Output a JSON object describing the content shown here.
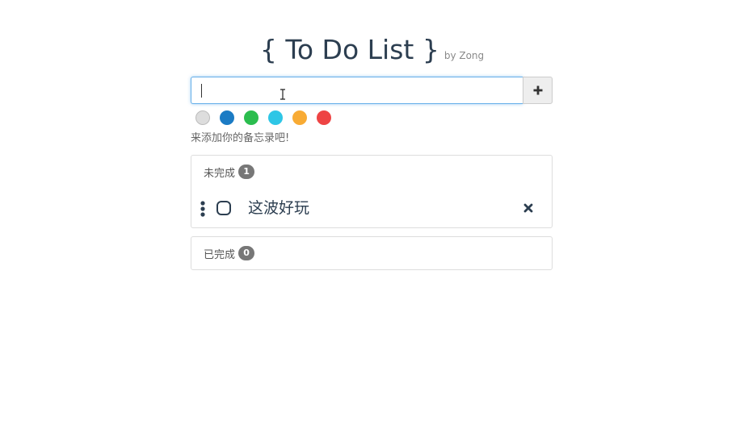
{
  "header": {
    "title": "{ To Do List }",
    "byline": "by Zong"
  },
  "input": {
    "value": "",
    "placeholder": ""
  },
  "add_button": {
    "icon": "plus-icon"
  },
  "colors": [
    "#dddddd",
    "#1b7bc4",
    "#2bbd4e",
    "#2ec6e6",
    "#f8ab34",
    "#ee4444"
  ],
  "hint": "来添加你的备忘录吧!",
  "pending": {
    "label": "未完成",
    "count": "1",
    "items": [
      {
        "text": "这波好玩"
      }
    ]
  },
  "done": {
    "label": "已完成",
    "count": "0"
  }
}
